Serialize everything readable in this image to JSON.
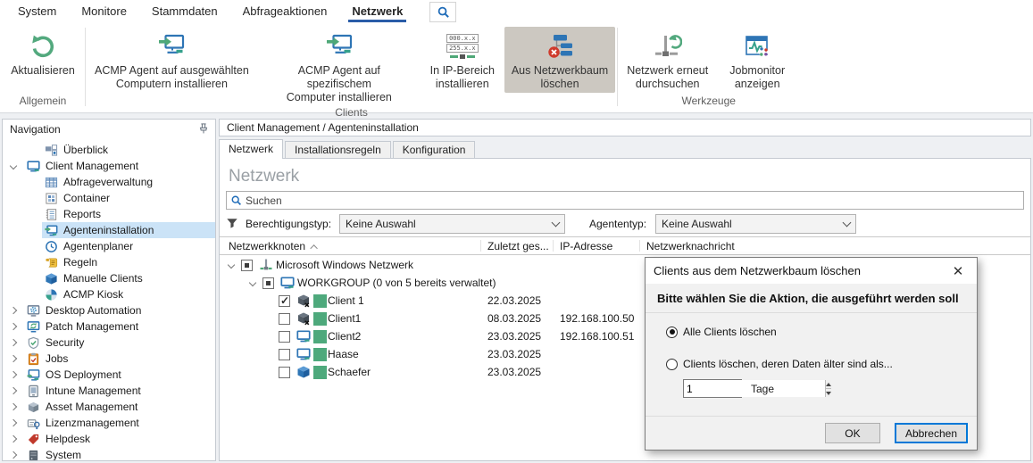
{
  "colors": {
    "accent_blue": "#2a5da8",
    "icon_blue": "#2e75b5",
    "icon_green": "#4fa878",
    "status_green": "#4ea97c",
    "selected_nav": "#cbe3f7",
    "pressed_ribbon": "#ccc8c1",
    "danger_red": "#cf3a2b",
    "focus_border": "#0078d7"
  },
  "ribbon": {
    "tabs": [
      {
        "label": "System",
        "active": false
      },
      {
        "label": "Monitore",
        "active": false
      },
      {
        "label": "Stammdaten",
        "active": false
      },
      {
        "label": "Abfrageaktionen",
        "active": false
      },
      {
        "label": "Netzwerk",
        "active": true
      }
    ],
    "search_icon": "search-icon",
    "groups": [
      {
        "label": "Allgemein",
        "buttons": [
          {
            "label": "Aktualisieren",
            "icon": "refresh",
            "pressed": false,
            "width": 90
          }
        ]
      },
      {
        "label": "Clients",
        "buttons": [
          {
            "label": "ACMP Agent auf ausgewählten\nComputern installieren",
            "icon": "agent-install",
            "pressed": false,
            "width": 190
          },
          {
            "label": "ACMP Agent auf spezifischem\nComputer installieren",
            "icon": "agent-install",
            "pressed": false,
            "width": 182
          },
          {
            "label": "In IP-Bereich\ninstallieren",
            "icon": "ip-range",
            "ip_top": "000.x.x",
            "ip_bottom": "255.x.x",
            "pressed": false,
            "width": 92
          },
          {
            "label": "Aus Netzwerkbaum\nlöschen",
            "icon": "tree-delete",
            "pressed": true,
            "width": 125
          }
        ]
      },
      {
        "label": "Werkzeuge",
        "buttons": [
          {
            "label": "Netzwerk erneut\ndurchsuchen",
            "icon": "network-refresh",
            "pressed": false,
            "width": 108
          },
          {
            "label": "Jobmonitor\nanzeigen",
            "icon": "jobmonitor",
            "pressed": false,
            "width": 90
          }
        ]
      }
    ]
  },
  "nav": {
    "title": "Navigation",
    "pin_icon": "pin-icon",
    "items": [
      {
        "label": "Überblick",
        "icon": "overview",
        "level": 1,
        "chevron": "none",
        "selected": false
      },
      {
        "label": "Client Management",
        "icon": "monitor",
        "level": 0,
        "chevron": "down",
        "selected": false
      },
      {
        "label": "Abfrageverwaltung",
        "icon": "table",
        "level": 1,
        "chevron": "none",
        "selected": false
      },
      {
        "label": "Container",
        "icon": "container",
        "level": 1,
        "chevron": "none",
        "selected": false
      },
      {
        "label": "Reports",
        "icon": "reports",
        "level": 1,
        "chevron": "none",
        "selected": false
      },
      {
        "label": "Agenteninstallation",
        "icon": "agent-install-sm",
        "level": 1,
        "chevron": "none",
        "selected": true
      },
      {
        "label": "Agentenplaner",
        "icon": "clock",
        "level": 1,
        "chevron": "none",
        "selected": false
      },
      {
        "label": "Regeln",
        "icon": "scroll",
        "level": 1,
        "chevron": "none",
        "selected": false
      },
      {
        "label": "Manuelle Clients",
        "icon": "cube-blue",
        "level": 1,
        "chevron": "none",
        "selected": false
      },
      {
        "label": "ACMP Kiosk",
        "icon": "kiosk",
        "level": 1,
        "chevron": "none",
        "selected": false
      },
      {
        "label": "Desktop Automation",
        "icon": "desktop-automation",
        "level": 0,
        "chevron": "right",
        "selected": false
      },
      {
        "label": "Patch Management",
        "icon": "patch",
        "level": 0,
        "chevron": "right",
        "selected": false
      },
      {
        "label": "Security",
        "icon": "shield",
        "level": 0,
        "chevron": "right",
        "selected": false
      },
      {
        "label": "Jobs",
        "icon": "jobs",
        "level": 0,
        "chevron": "right",
        "selected": false
      },
      {
        "label": "OS Deployment",
        "icon": "os-deploy",
        "level": 0,
        "chevron": "right",
        "selected": false
      },
      {
        "label": "Intune Management",
        "icon": "intune",
        "level": 0,
        "chevron": "right",
        "selected": false
      },
      {
        "label": "Asset Management",
        "icon": "asset",
        "level": 0,
        "chevron": "right",
        "selected": false
      },
      {
        "label": "Lizenzmanagement",
        "icon": "license",
        "level": 0,
        "chevron": "right",
        "selected": false
      },
      {
        "label": "Helpdesk",
        "icon": "helpdesk",
        "level": 0,
        "chevron": "right",
        "selected": false
      },
      {
        "label": "System",
        "icon": "system",
        "level": 0,
        "chevron": "right",
        "selected": false
      }
    ]
  },
  "main": {
    "breadcrumb": "Client Management / Agenteninstallation",
    "tabs": [
      {
        "label": "Netzwerk",
        "active": true
      },
      {
        "label": "Installationsregeln",
        "active": false
      },
      {
        "label": "Konfiguration",
        "active": false
      }
    ],
    "heading": "Netzwerk",
    "search_placeholder": "Suchen",
    "filters": [
      {
        "label": "Berechtigungstyp:",
        "value": "Keine Auswahl"
      },
      {
        "label": "Agententyp:",
        "value": "Keine Auswahl"
      }
    ],
    "table": {
      "columns": [
        "Netzwerkknoten",
        "Zuletzt ges...",
        "IP-Adresse",
        "Netzwerknachricht"
      ],
      "sort_column": "Netzwerkknoten",
      "sort_direction": "asc",
      "rows": [
        {
          "name": "Microsoft Windows Netzwerk",
          "level": 0,
          "chevron": "down",
          "checkbox": "indeterminate",
          "icon": "network-node",
          "status": false,
          "last_seen": "",
          "ip": "",
          "message": ""
        },
        {
          "name": "WORKGROUP (0 von 5 bereits verwaltet)",
          "level": 1,
          "chevron": "down",
          "checkbox": "indeterminate",
          "icon": "monitor",
          "status": false,
          "last_seen": "",
          "ip": "",
          "message": ""
        },
        {
          "name": "Client 1",
          "level": 2,
          "chevron": "none",
          "checkbox": "checked",
          "icon": "client-offline",
          "status": true,
          "last_seen": "22.03.2025",
          "ip": "",
          "message": ""
        },
        {
          "name": "Client1",
          "level": 2,
          "chevron": "none",
          "checkbox": "unchecked",
          "icon": "client-offline",
          "status": true,
          "last_seen": "08.03.2025",
          "ip": "192.168.100.50",
          "message": ""
        },
        {
          "name": "Client2",
          "level": 2,
          "chevron": "none",
          "checkbox": "unchecked",
          "icon": "monitor",
          "status": true,
          "last_seen": "23.03.2025",
          "ip": "192.168.100.51",
          "message": ""
        },
        {
          "name": "Haase",
          "level": 2,
          "chevron": "none",
          "checkbox": "unchecked",
          "icon": "monitor",
          "status": true,
          "last_seen": "23.03.2025",
          "ip": "",
          "message": ""
        },
        {
          "name": "Schaefer",
          "level": 2,
          "chevron": "none",
          "checkbox": "unchecked",
          "icon": "cube-blue",
          "status": true,
          "last_seen": "23.03.2025",
          "ip": "",
          "message": ""
        }
      ]
    }
  },
  "dialog": {
    "title": "Clients aus dem Netzwerkbaum löschen",
    "close_icon": "close-icon",
    "message": "Bitte wählen Sie die Aktion, die ausgeführt werden soll",
    "options": [
      {
        "label": "Alle Clients löschen",
        "selected": true
      },
      {
        "label": "Clients löschen, deren Daten älter sind als...",
        "selected": false
      }
    ],
    "days_value": "1",
    "days_unit": "Tage",
    "buttons": [
      {
        "label": "OK",
        "default": false
      },
      {
        "label": "Abbrechen",
        "default": true
      }
    ]
  }
}
